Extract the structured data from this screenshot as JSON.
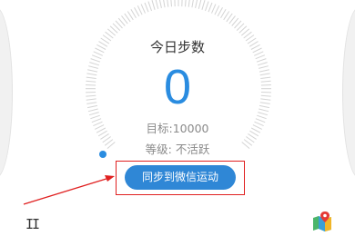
{
  "title": "今日步数",
  "steps": "0",
  "goal": "目标:10000",
  "level": "等级: 不活跃",
  "sync_button": "同步到微信运动",
  "pause_icon": "II",
  "side_left_arrow": "‹",
  "side_right_arrow": "›",
  "progress": 0,
  "colors": {
    "accent": "#2a8ce0",
    "button": "#2f87d6",
    "highlight": "#e02020",
    "text_muted": "#8a8a8a"
  },
  "icons": [
    "pause-icon",
    "map-location-icon",
    "chevron-left-icon",
    "chevron-right-icon"
  ]
}
